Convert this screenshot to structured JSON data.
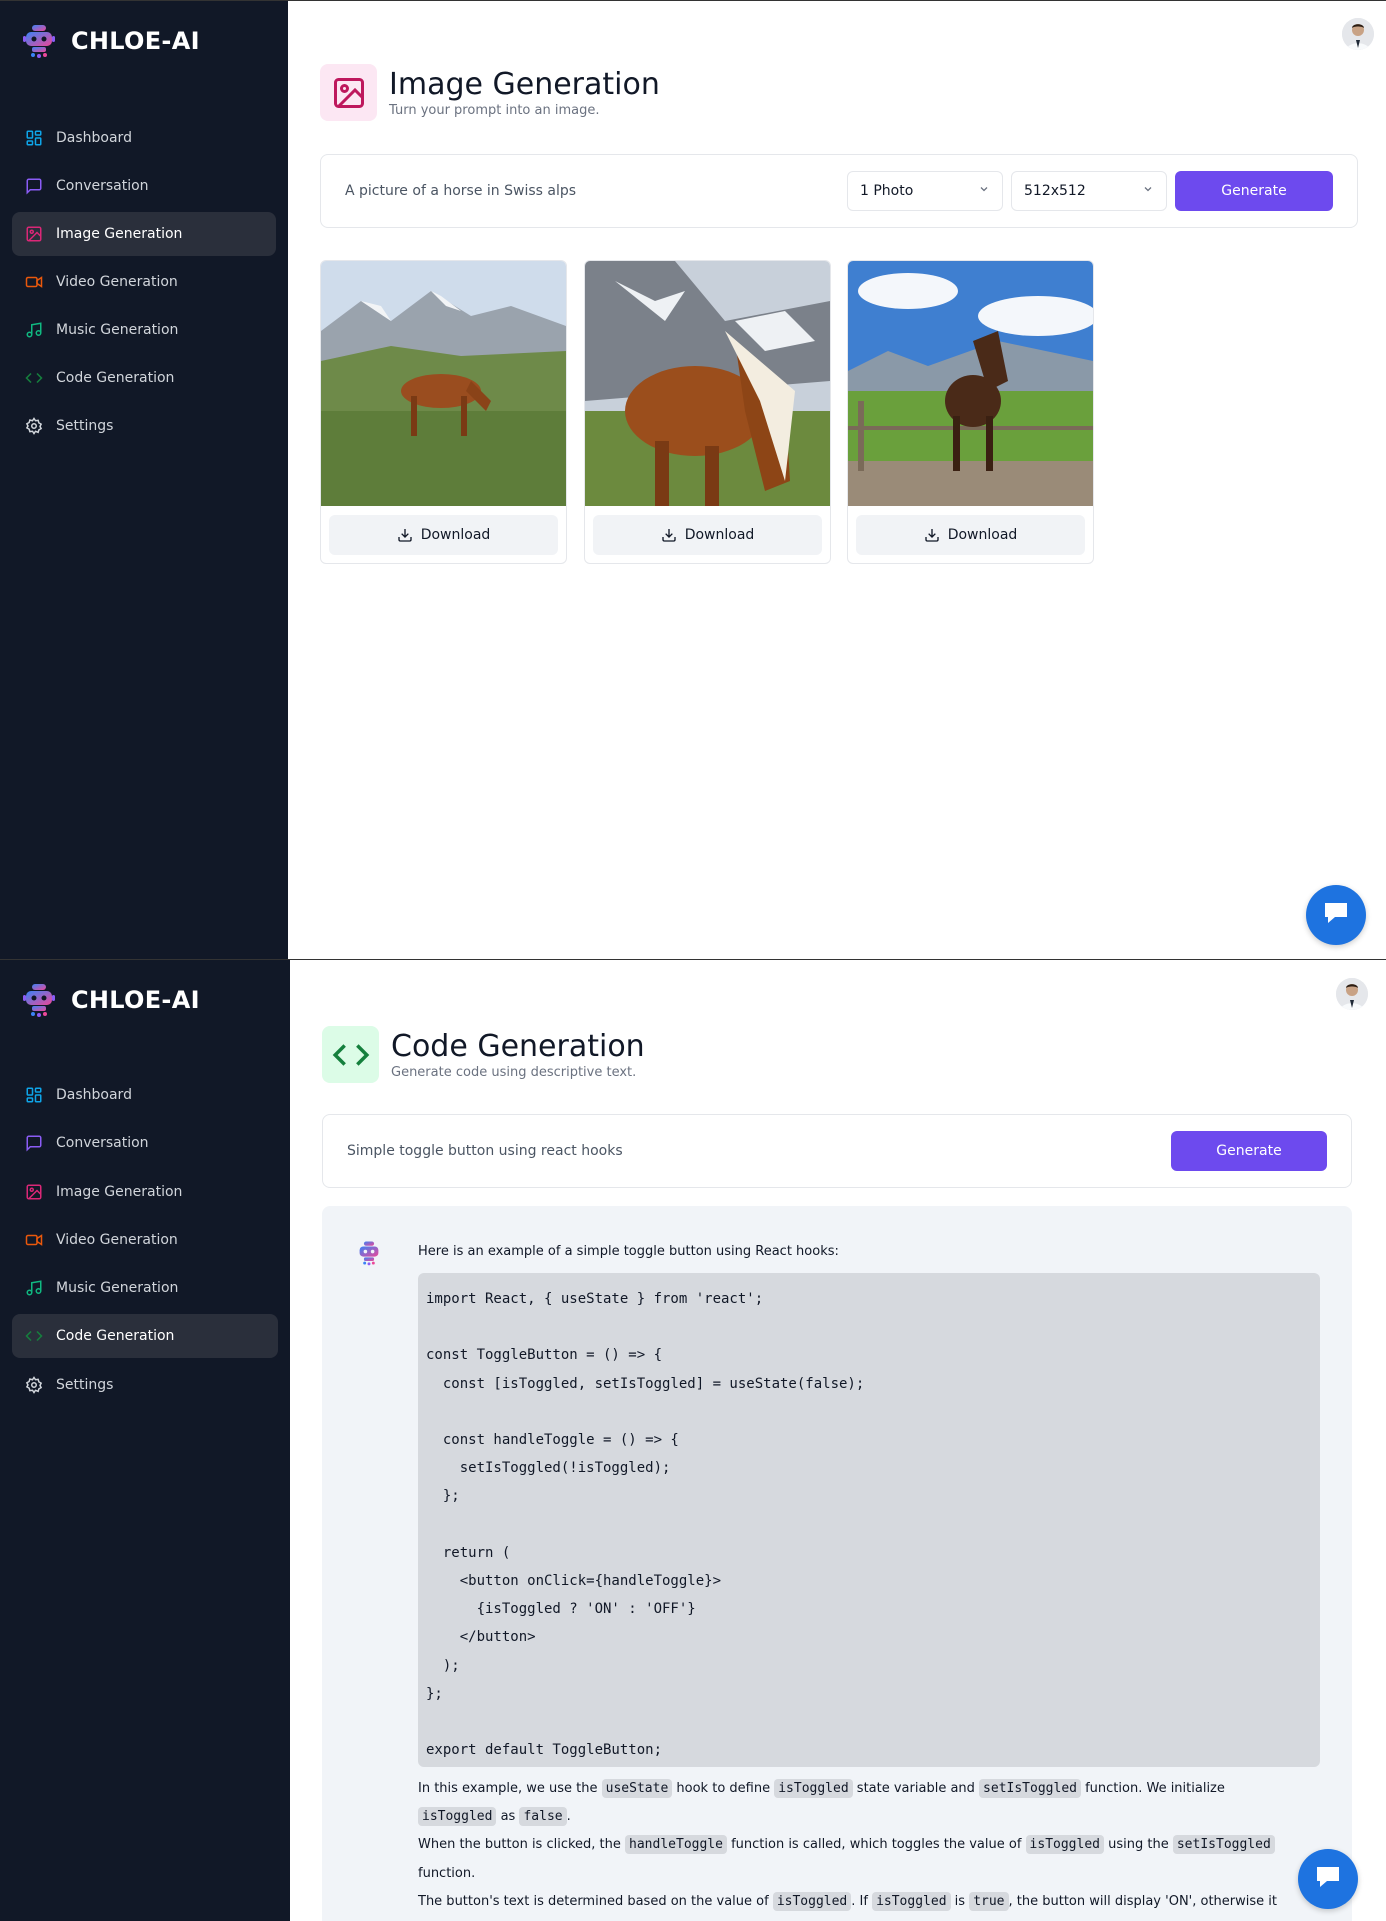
{
  "brand": {
    "name": "CHLOE-AI"
  },
  "sidebar": {
    "items": [
      {
        "label": "Dashboard",
        "icon": "layout-dashboard-icon",
        "color": "#0ea5e9"
      },
      {
        "label": "Conversation",
        "icon": "message-square-icon",
        "color": "#8b5cf6"
      },
      {
        "label": "Image Generation",
        "icon": "image-icon",
        "color": "#db2777"
      },
      {
        "label": "Video Generation",
        "icon": "video-icon",
        "color": "#ea580c"
      },
      {
        "label": "Music Generation",
        "icon": "music-icon",
        "color": "#10b981"
      },
      {
        "label": "Code Generation",
        "icon": "code-icon",
        "color": "#15803d"
      },
      {
        "label": "Settings",
        "icon": "settings-icon",
        "color": "#d1d5db"
      }
    ]
  },
  "image_page": {
    "title": "Image Generation",
    "subtitle": "Turn your prompt into an image.",
    "prompt_value": "A picture of a horse in Swiss alps",
    "amount_value": "1 Photo",
    "resolution_value": "512x512",
    "generate_label": "Generate",
    "active_nav": "Image Generation",
    "results": [
      {
        "download_label": "Download"
      },
      {
        "download_label": "Download"
      },
      {
        "download_label": "Download"
      }
    ]
  },
  "code_page": {
    "title": "Code Generation",
    "subtitle": "Generate code using descriptive text.",
    "prompt_value": "Simple toggle button using react hooks",
    "generate_label": "Generate",
    "active_nav": "Code Generation",
    "answer_intro": "Here is an example of a simple toggle button using React hooks:",
    "code": "import React, { useState } from 'react';\n\nconst ToggleButton = () => {\n  const [isToggled, setIsToggled] = useState(false);\n\n  const handleToggle = () => {\n    setIsToggled(!isToggled);\n  };\n\n  return (\n    <button onClick={handleToggle}>\n      {isToggled ? 'ON' : 'OFF'}\n    </button>\n  );\n};\n\nexport default ToggleButton;",
    "explain_1a": "In this example, we use the ",
    "explain_1b": "useState",
    "explain_1c": " hook to define ",
    "explain_1d": "isToggled",
    "explain_1e": " state variable and ",
    "explain_1f": "setIsToggled",
    "explain_1g": " function. We initialize ",
    "explain_1h": "isToggled",
    "explain_1i": " as ",
    "explain_1j": "false",
    "explain_1k": ".",
    "explain_2a": "When the button is clicked, the ",
    "explain_2b": "handleToggle",
    "explain_2c": " function is called, which toggles the value of ",
    "explain_2d": "isToggled",
    "explain_2e": " using the ",
    "explain_2f": "setIsToggled",
    "explain_2g": " function.",
    "explain_3a": "The button's text is determined based on the value of ",
    "explain_3b": "isToggled",
    "explain_3c": ". If ",
    "explain_3d": "isToggled",
    "explain_3e": " is ",
    "explain_3f": "true",
    "explain_3g": ", the button will display 'ON', otherwise it will"
  },
  "colors": {
    "sidebar_bg": "#111827",
    "accent": "#6d4aee",
    "chat_fab": "#1e73e0"
  }
}
